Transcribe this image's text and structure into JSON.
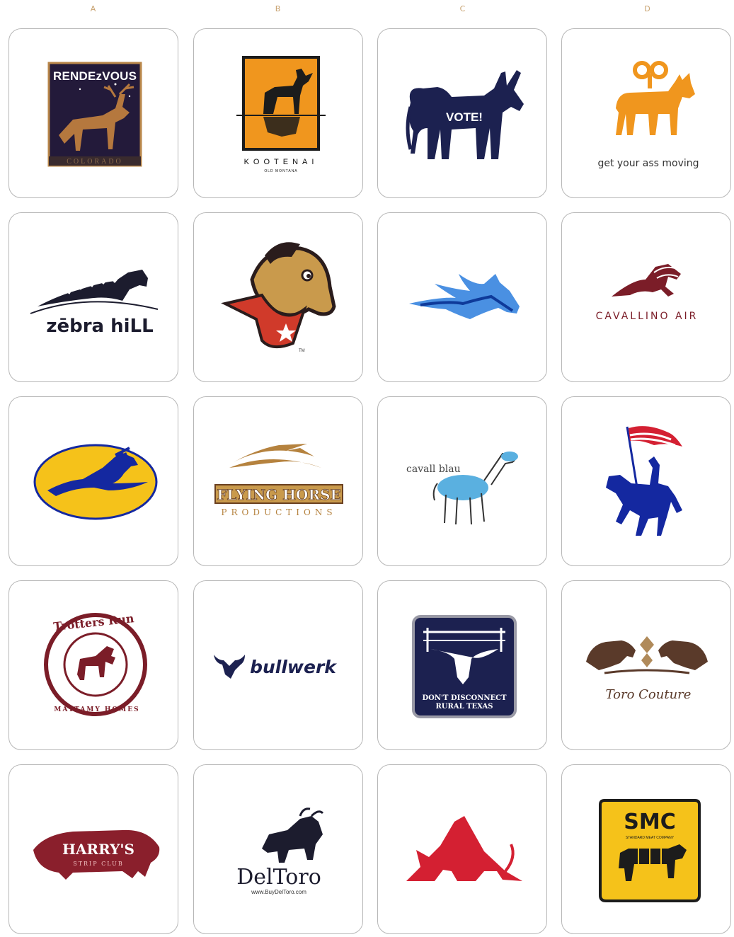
{
  "page": {
    "column_labels": [
      "A",
      "B",
      "C",
      "D"
    ],
    "label_color": "#c8a270"
  },
  "logos": {
    "a1": {
      "text": "RENDEzVOUS",
      "subtext": "COLORADO"
    },
    "b1": {
      "text": "KOOTENAI",
      "subtext": "OLD MONTANA"
    },
    "c1": {
      "text": "VOTE!"
    },
    "d1": {
      "text": "get your ass moving"
    },
    "a2": {
      "text": "zēbra hiLL"
    },
    "b2": {
      "text": "TM"
    },
    "c2": {},
    "d2": {
      "text": "CAVALLINO AIR"
    },
    "a3": {},
    "b3": {
      "text": "FLYING HORSE",
      "subtext": "PRODUCTIONS"
    },
    "c3": {
      "text": "cavall blau"
    },
    "d3": {},
    "a4": {
      "text": "Trotters Run",
      "subtext": "MATTAMY HOMES"
    },
    "b4": {
      "text": "bullwerk"
    },
    "c4": {
      "text": "DON'T DISCONNECT",
      "subtext": "RURAL TEXAS"
    },
    "d4": {
      "text": "Toro Couture"
    },
    "a5": {
      "text": "HARRY'S",
      "subtext": "STRIP CLUB"
    },
    "b5": {
      "text": "DelToro",
      "subtext": "www.BuyDelToro.com"
    },
    "c5": {},
    "d5": {
      "text": "SMC",
      "subtext": "STANDARD MEAT COMPANY"
    }
  },
  "colors": {
    "navy": "#1c2150",
    "orange": "#f0961e",
    "maroon": "#7b1d28",
    "blue": "#1428a0",
    "yellow": "#f5c21a",
    "red": "#d42032",
    "brown": "#b5823e"
  }
}
